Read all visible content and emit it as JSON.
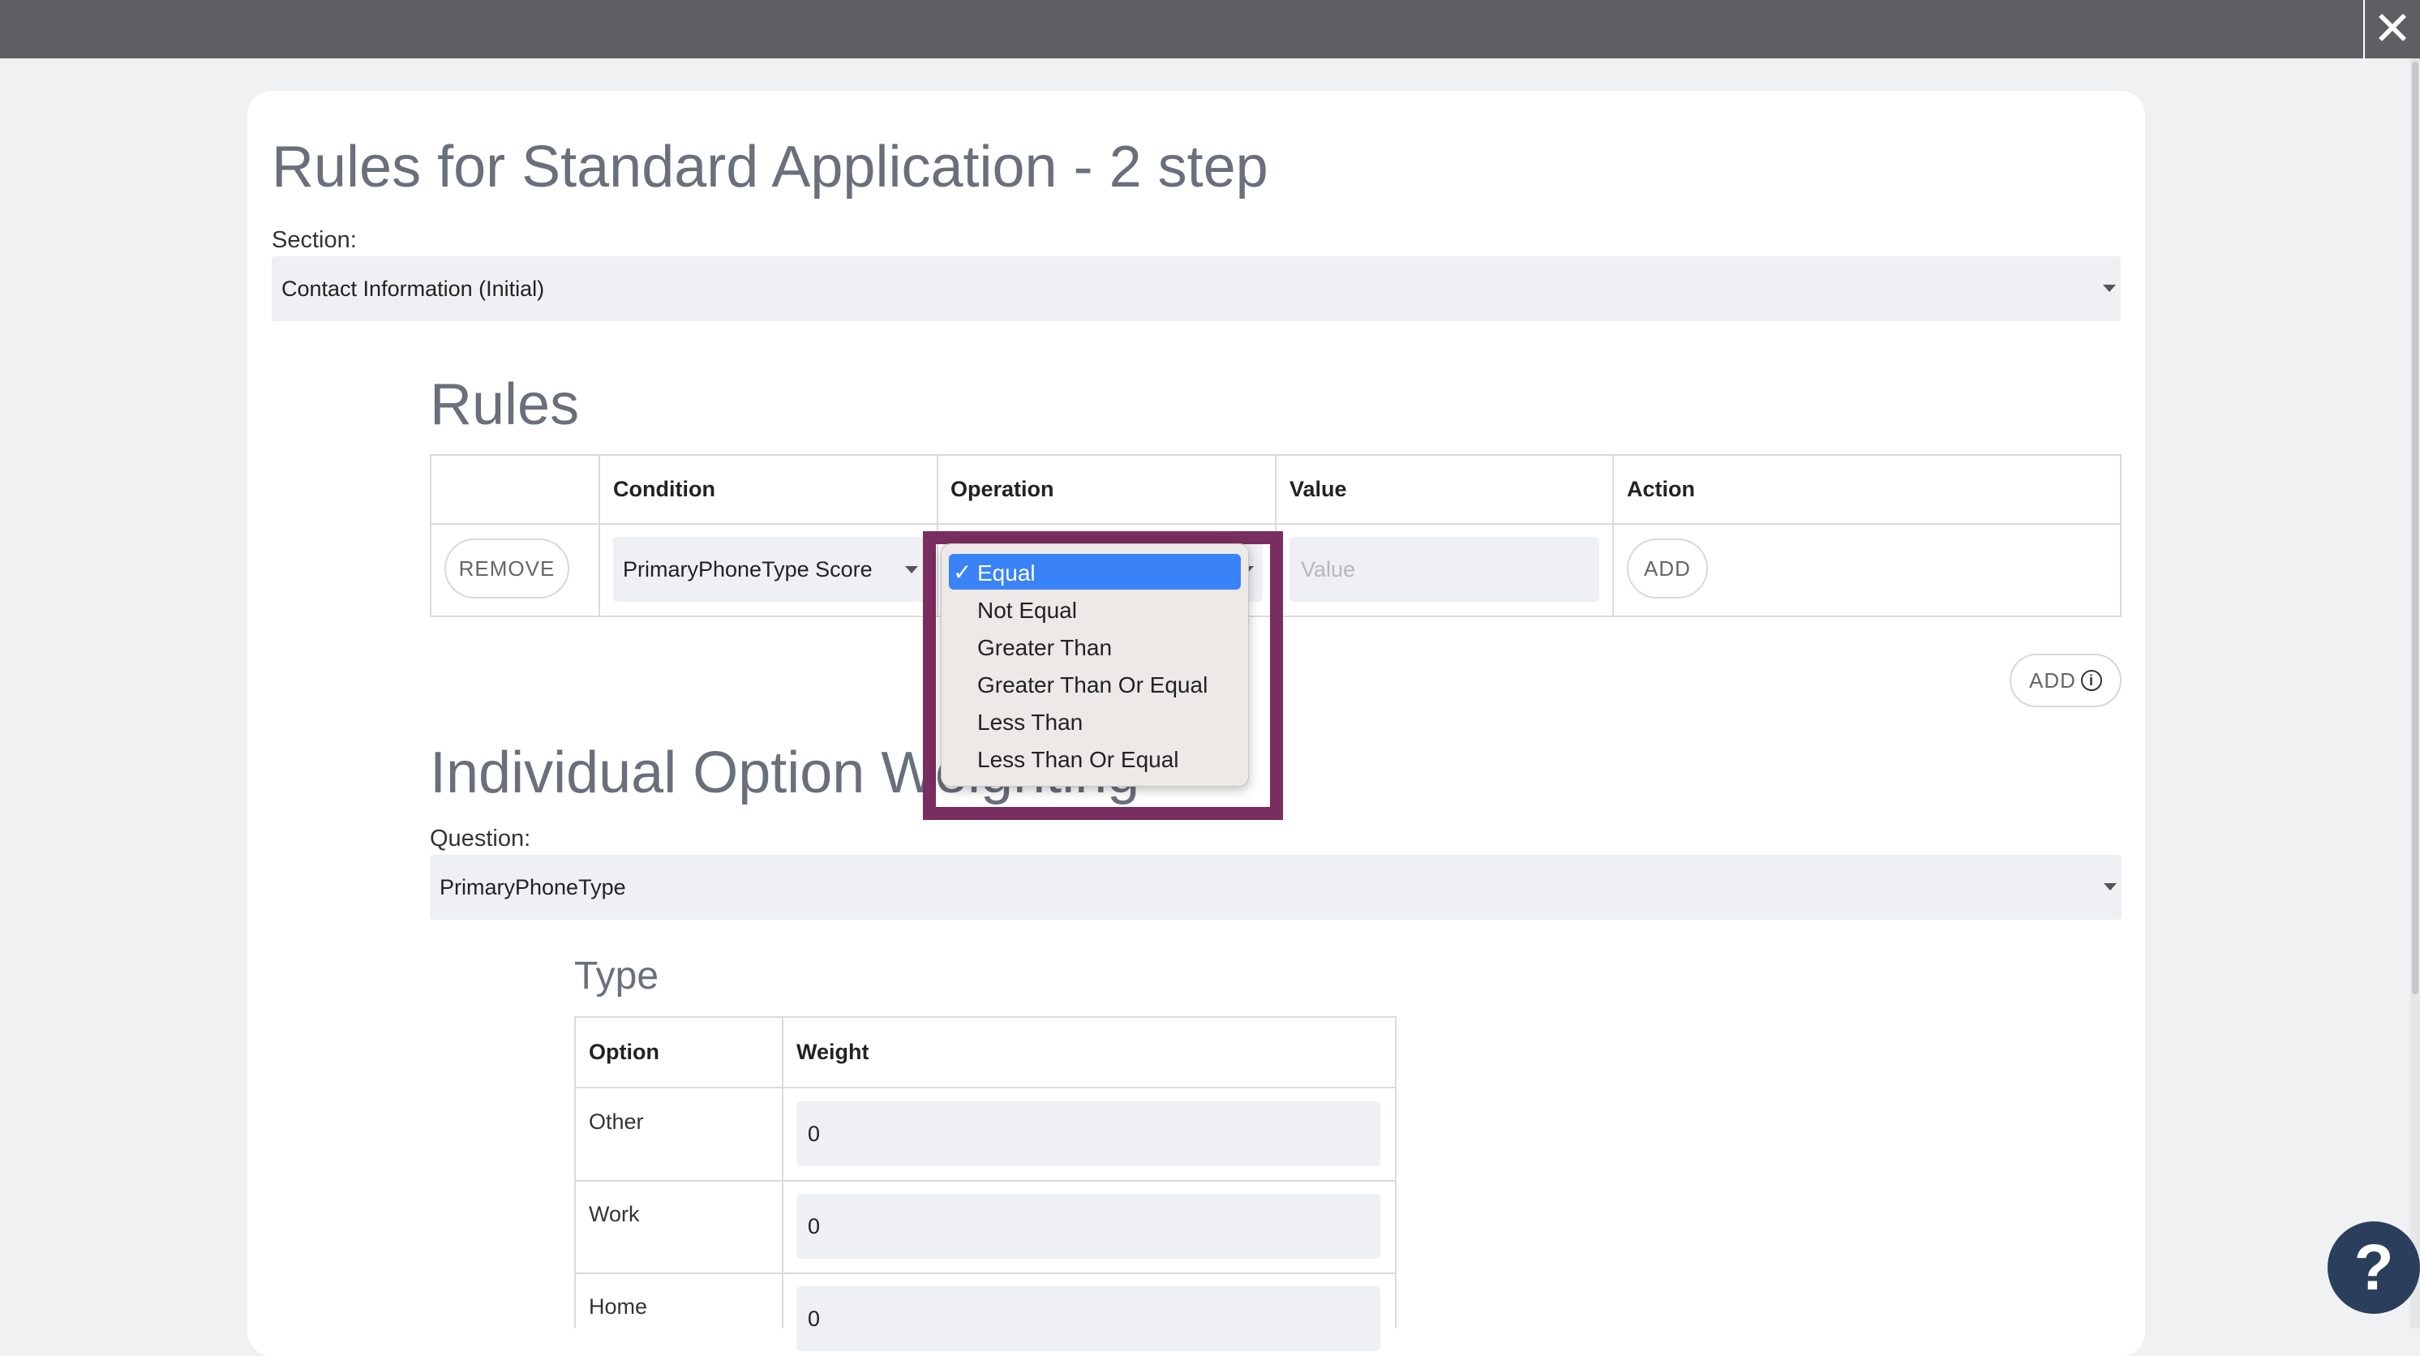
{
  "window": {
    "close_icon": "close-icon"
  },
  "page": {
    "title": "Rules for Standard Application - 2 step",
    "section_label": "Section:",
    "section_value": "Contact Information (Initial)"
  },
  "rules": {
    "heading": "Rules",
    "columns": [
      "Condition",
      "Operation",
      "Value",
      "Action"
    ],
    "row": {
      "remove_label": "REMOVE",
      "condition_value": "PrimaryPhoneType Score",
      "value_placeholder": "Value",
      "add_label": "ADD"
    },
    "add_rule_label": "ADD",
    "add_rule_icon": "info-icon"
  },
  "operation_dropdown": {
    "selected": "Equal",
    "check_glyph": "✓",
    "options": [
      "Equal",
      "Not Equal",
      "Greater Than",
      "Greater Than Or Equal",
      "Less Than",
      "Less Than Or Equal"
    ]
  },
  "weighting": {
    "heading": "Individual Option Weighting",
    "question_label": "Question:",
    "question_value": "PrimaryPhoneType",
    "type_heading": "Type",
    "columns": [
      "Option",
      "Weight"
    ],
    "rows": [
      {
        "option": "Other",
        "weight": "0"
      },
      {
        "option": "Work",
        "weight": "0"
      },
      {
        "option": "Home",
        "weight": "0"
      }
    ]
  },
  "help": {
    "glyph": "?",
    "icon": "help-icon"
  },
  "colors": {
    "topbar": "#5d5f62",
    "highlight": "#7a2d5f",
    "selected_option": "#3a82f7",
    "help_button": "#2b3f5c"
  }
}
